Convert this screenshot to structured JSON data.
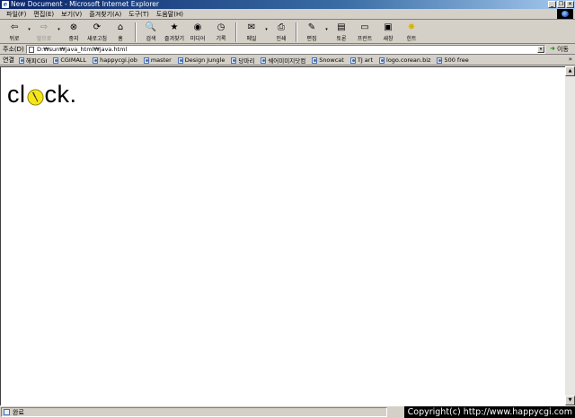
{
  "window": {
    "title": "New Document - Microsoft Internet Explorer",
    "minimize_glyph": "_",
    "maximize_glyph": "❐",
    "close_glyph": "✕"
  },
  "menubar": {
    "items": [
      {
        "label": "파일(F)"
      },
      {
        "label": "편집(E)"
      },
      {
        "label": "보기(V)"
      },
      {
        "label": "즐겨찾기(A)"
      },
      {
        "label": "도구(T)"
      },
      {
        "label": "도움말(H)"
      }
    ]
  },
  "toolbar": {
    "back": {
      "label": "뒤로",
      "icon": "back-arrow-icon",
      "glyph": "⇦"
    },
    "forward": {
      "label": "앞으로",
      "icon": "forward-arrow-icon",
      "glyph": "⇨"
    },
    "stop": {
      "label": "중지",
      "icon": "stop-icon",
      "glyph": "⊗"
    },
    "refresh": {
      "label": "새로고침",
      "icon": "refresh-icon",
      "glyph": "⟳"
    },
    "home": {
      "label": "홈",
      "icon": "home-icon",
      "glyph": "⌂"
    },
    "search": {
      "label": "검색",
      "icon": "search-icon",
      "glyph": "🔍"
    },
    "favorites": {
      "label": "즐겨찾기",
      "icon": "favorites-icon",
      "glyph": "★"
    },
    "media": {
      "label": "미디어",
      "icon": "media-icon",
      "glyph": "◉"
    },
    "history": {
      "label": "기록",
      "icon": "history-icon",
      "glyph": "◷"
    },
    "mail": {
      "label": "메일",
      "icon": "mail-icon",
      "glyph": "✉"
    },
    "print": {
      "label": "인쇄",
      "icon": "print-icon",
      "glyph": "⎙"
    },
    "edit": {
      "label": "편집",
      "icon": "edit-icon",
      "glyph": "✎"
    },
    "discuss": {
      "label": "토론",
      "icon": "discuss-icon",
      "glyph": "▤"
    },
    "printer2": {
      "label": "프린트",
      "icon": "printer-icon",
      "glyph": "▭"
    },
    "new": {
      "label": "새창",
      "icon": "new-window-icon",
      "glyph": "▣"
    },
    "hint": {
      "label": "힌트",
      "icon": "lightbulb-icon",
      "glyph": "✸"
    },
    "dropdown_glyph": "▾"
  },
  "address": {
    "label": "주소(D)",
    "value": "D:₩sun₩java_html₩java.html",
    "go_label": "이동",
    "go_glyph": "➜",
    "dropdown_glyph": "▾"
  },
  "links": {
    "label": "연결",
    "items": [
      {
        "label": "해피CGI"
      },
      {
        "label": "CGIMALL"
      },
      {
        "label": "happycgi.job"
      },
      {
        "label": "master"
      },
      {
        "label": "Design Jungle"
      },
      {
        "label": "당마리"
      },
      {
        "label": "쉐어미미지닷컴"
      },
      {
        "label": "Snowcat"
      },
      {
        "label": "TJ art"
      },
      {
        "label": "logo.corean.biz"
      },
      {
        "label": "500 free"
      }
    ],
    "more_glyph": "»"
  },
  "page": {
    "text_before": "cl",
    "text_after": "ck.",
    "clock_icon": "clock-icon",
    "clock_color": "#f5e61a"
  },
  "scrollbar": {
    "up_glyph": "▲",
    "down_glyph": "▼"
  },
  "status": {
    "text": "완료",
    "copyright": "Copyright(c) http://www.happycgi.com"
  },
  "colors": {
    "title_start": "#0a246a",
    "title_end": "#a6caf0",
    "chrome": "#d4d0c8"
  }
}
